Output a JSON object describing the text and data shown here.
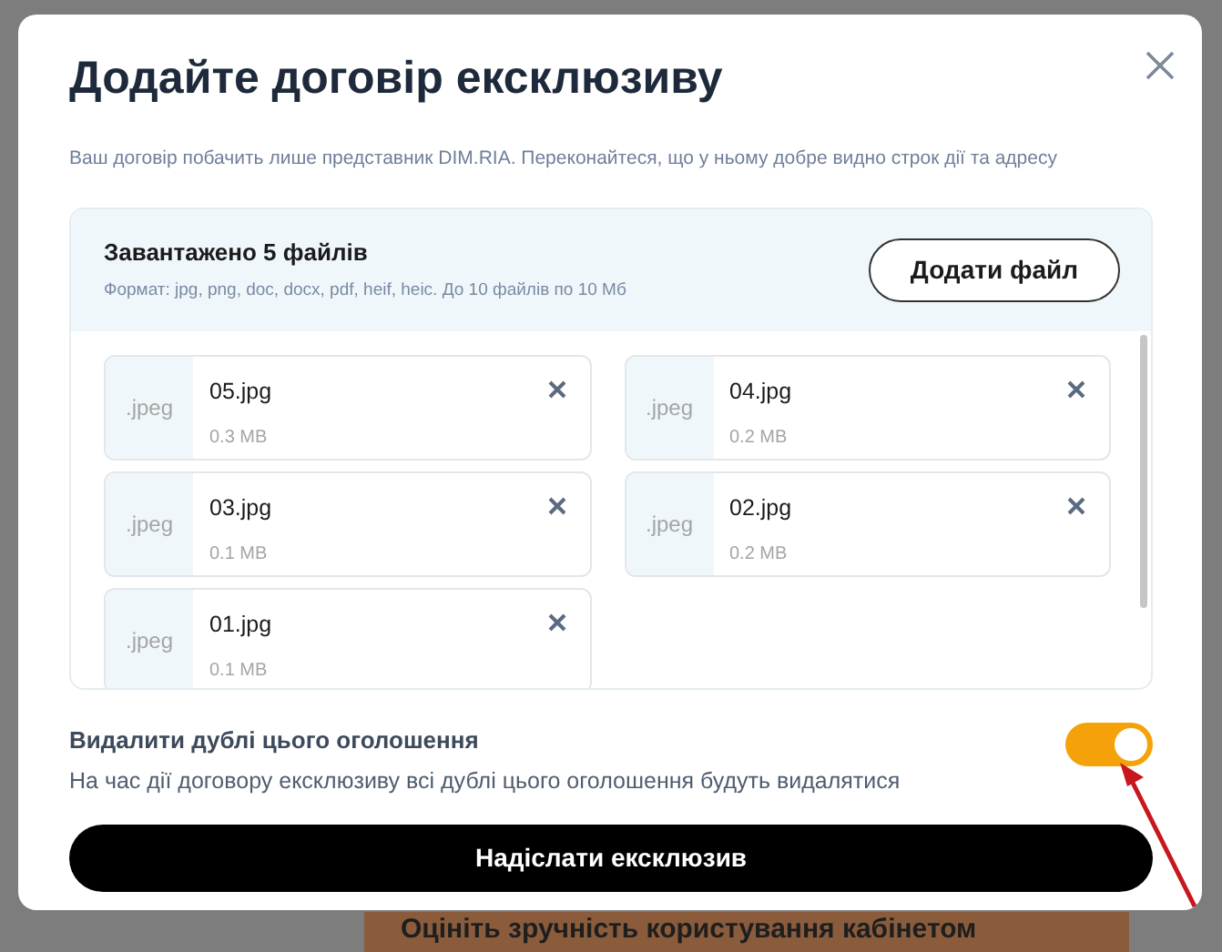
{
  "background": {
    "banner": "Оцініть зручність користування кабінетом"
  },
  "dialog": {
    "title": "Додайте договір ексклюзиву",
    "subtitle": "Ваш договір побачить лише представник DIM.RIA. Переконайтеся, що у ньому добре видно строк дії та адресу",
    "upload": {
      "heading": "Завантажено 5 файлів",
      "hint": "Формат: jpg, png, doc, docx, pdf, heif, heic. До 10 файлів по 10 Мб",
      "button": "Додати файл",
      "files": [
        {
          "type": ".jpeg",
          "name": "05.jpg",
          "size": "0.3 MB"
        },
        {
          "type": ".jpeg",
          "name": "04.jpg",
          "size": "0.2 MB"
        },
        {
          "type": ".jpeg",
          "name": "03.jpg",
          "size": "0.1 MB"
        },
        {
          "type": ".jpeg",
          "name": "02.jpg",
          "size": "0.2 MB"
        },
        {
          "type": ".jpeg",
          "name": "01.jpg",
          "size": "0.1 MB"
        }
      ]
    },
    "option": {
      "title": "Видалити дублі цього оголошення",
      "description": "На час дії договору ексклюзиву всі дублі цього оголошення будуть видалятися",
      "on": true
    },
    "submit": "Надіслати ексклюзив"
  }
}
